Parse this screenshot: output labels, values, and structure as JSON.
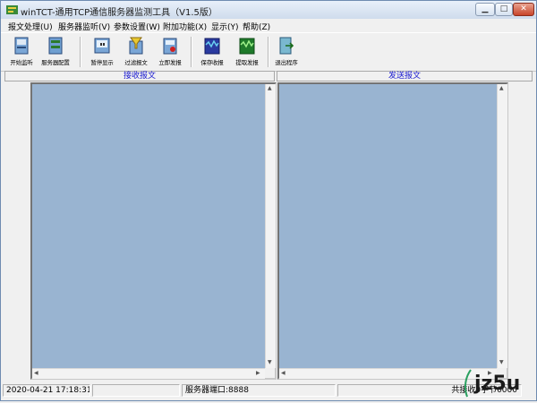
{
  "window": {
    "title": "winTCT-通用TCP通信服务器监测工具（V1.5版）"
  },
  "menu": [
    {
      "label": "报文处理(U)"
    },
    {
      "label": "服务器监听(V)"
    },
    {
      "label": "参数设置(W)"
    },
    {
      "label": "附加功能(X)"
    },
    {
      "label": "显示(Y)"
    },
    {
      "label": "帮助(Z)"
    }
  ],
  "toolbar": [
    {
      "label": "开始监听",
      "icon": "start-listen-icon"
    },
    {
      "label": "服务器配置",
      "icon": "server-config-icon"
    },
    {
      "label": "暂停显示",
      "icon": "pause-display-icon"
    },
    {
      "label": "过滤报文",
      "icon": "filter-icon"
    },
    {
      "label": "立即发报",
      "icon": "send-now-icon"
    },
    {
      "label": "保存收报",
      "icon": "save-received-icon"
    },
    {
      "label": "提取发报",
      "icon": "extract-send-icon"
    },
    {
      "label": "退出程序",
      "icon": "exit-icon"
    }
  ],
  "panels": {
    "receive_title": "接收报文",
    "send_title": "发送报文"
  },
  "status": {
    "datetime": "2020-04-21 17:18:31",
    "port": "服务器端口:8888",
    "right": "共接收0字节0000"
  },
  "watermark": {
    "text": "jz5u"
  },
  "colors": {
    "pane_bg": "#99b4d1",
    "header_text": "#1a1ad0"
  }
}
